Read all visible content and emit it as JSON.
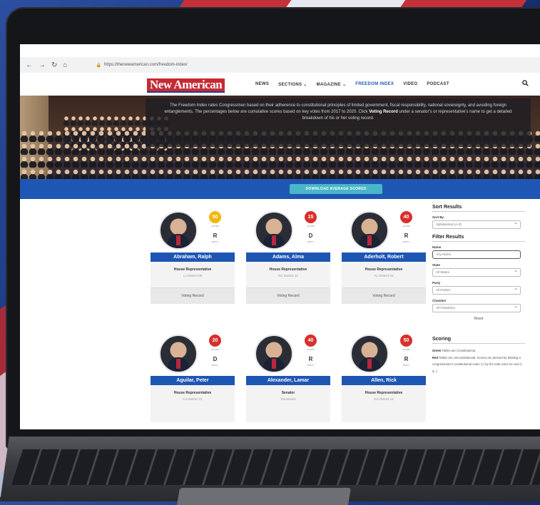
{
  "browser": {
    "url": "https://thenewamerican.com/freedom-index/",
    "back": "←",
    "forward": "→",
    "reload": "↻",
    "home": "⌂"
  },
  "header": {
    "logo": "New American",
    "nav": [
      {
        "label": "NEWS"
      },
      {
        "label": "SECTIONS ⌄"
      },
      {
        "label": "MAGAZINE ⌄"
      },
      {
        "label": "FREEDOM INDEX"
      },
      {
        "label": "VIDEO"
      },
      {
        "label": "PODCAST"
      }
    ],
    "search_icon": "search-icon"
  },
  "hero": {
    "text_a": "The Freedom Index rates Congressmen based on their adherence to constitutional principles of limited government, fiscal responsibility, national sovereignty, and avoiding foreign entanglements. The percentages below are cumulative scores based on key votes from 2017 to 2020. Click ",
    "text_bold": "Voting Record",
    "text_b": " under a senator's or representative's name to get a detailed breakdown of his or her voting record."
  },
  "banner": {
    "button_label": "DOWNLOAD AVERAGE SCORES"
  },
  "colors": {
    "score_yellow": "#f2b705",
    "score_red": "#d8302b",
    "brand_blue": "#1e56b4"
  },
  "cards": [
    {
      "name": "Abraham, Ralph",
      "score": "50",
      "score_label": "SCORE",
      "party": "R",
      "party_label": "PARTY",
      "role": "House Representative",
      "district": "LA District 05",
      "button": "Voting Record",
      "color": "#f2b705"
    },
    {
      "name": "Adams, Alma",
      "score": "15",
      "score_label": "SCORE",
      "party": "D",
      "party_label": "PARTY",
      "role": "House Representative",
      "district": "NC District 12",
      "button": "Voting Record",
      "color": "#d8302b"
    },
    {
      "name": "Aderholt, Robert",
      "score": "40",
      "score_label": "SCORE",
      "party": "R",
      "party_label": "PARTY",
      "role": "House Representative",
      "district": "AL District 04",
      "button": "Voting Record",
      "color": "#d8302b"
    },
    {
      "name": "Aguilar, Peter",
      "score": "20",
      "score_label": "SCORE",
      "party": "D",
      "party_label": "PARTY",
      "role": "House Representative",
      "district": "CA District 31",
      "button": "",
      "color": "#d8302b"
    },
    {
      "name": "Alexander, Lamar",
      "score": "40",
      "score_label": "SCORE",
      "party": "R",
      "party_label": "PARTY",
      "role": "Senator",
      "district": "Tennessee",
      "button": "",
      "color": "#d8302b"
    },
    {
      "name": "Allen, Rick",
      "score": "50",
      "score_label": "SCORE",
      "party": "R",
      "party_label": "PARTY",
      "role": "House Representative",
      "district": "GA District 12",
      "button": "",
      "color": "#d8302b"
    }
  ],
  "sidebar": {
    "sort_title": "Sort Results",
    "sort_by_label": "Sort By",
    "sort_by_value": "Alphabetical (A-Z)",
    "filter_title": "Filter Results",
    "name_label": "Name",
    "name_placeholder": "Any Name",
    "state_label": "State",
    "state_value": "All States",
    "party_label": "Party",
    "party_value": "All Parties",
    "chamber_label": "Chamber",
    "chamber_value": "All Chambers",
    "reset": "Reset",
    "scoring_title": "Scoring",
    "scoring_green": "Green",
    "scoring_text1": " Tallies are Constitutional.",
    "scoring_red": "Red",
    "scoring_text2": " Tallies are Unconstitutional. Scores are derived by dividing a congressman's constitutional votes (+) by the total votes he cast (+ & -)"
  }
}
